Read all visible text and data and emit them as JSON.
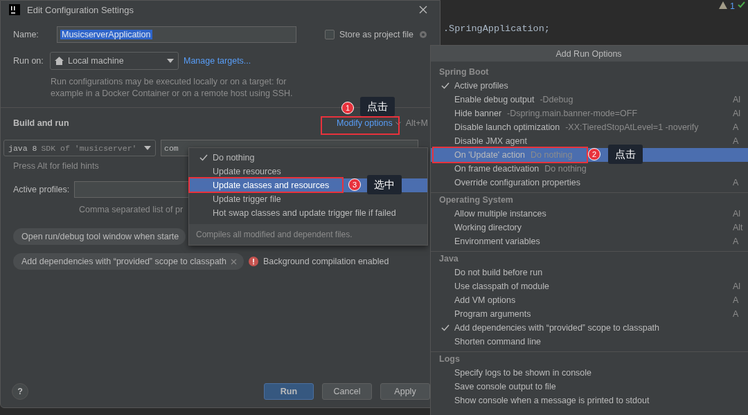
{
  "editor": {
    "code_line": ".SpringApplication;",
    "warning_count": "1"
  },
  "dialog": {
    "title": "Edit Configuration Settings",
    "name": {
      "label": "Name:",
      "value": "MusicserverApplication"
    },
    "store_as_project_file": {
      "label": "Store as project file",
      "checked": false
    },
    "run_on": {
      "label": "Run on:",
      "value": "Local machine",
      "link": "Manage targets..."
    },
    "run_on_hint": "Run configurations may be executed locally or on a target: for example in a Docker Container or on a remote host using SSH.",
    "section": "Build and run",
    "modify_options": {
      "label": "Modify options",
      "shortcut": "Alt+M"
    },
    "jre": {
      "version": "java 8",
      "sdk": "SDK of 'musicserver'"
    },
    "main_class": "com",
    "field_hints": "Press Alt for field hints",
    "active_profiles": {
      "label": "Active profiles:",
      "hint": "Comma separated list of pr"
    },
    "chips": [
      {
        "label": "Open run/debug tool window when starte",
        "removable": false
      },
      {
        "label": "Add dependencies with “provided” scope to classpath",
        "removable": true
      }
    ],
    "warning": "Background compilation enabled",
    "help": "?",
    "buttons": [
      {
        "label": "Run",
        "primary": true
      },
      {
        "label": "Cancel",
        "primary": false
      },
      {
        "label": "Apply",
        "primary": false
      }
    ]
  },
  "update_popup": {
    "items": [
      {
        "label": "Do nothing",
        "checked": true,
        "selected": false
      },
      {
        "label": "Update resources",
        "checked": false,
        "selected": false
      },
      {
        "label": "Update classes and resources",
        "checked": false,
        "selected": true
      },
      {
        "label": "Update trigger file",
        "checked": false,
        "selected": false
      },
      {
        "label": "Hot swap classes and update trigger file if failed",
        "checked": false,
        "selected": false
      }
    ],
    "footer": "Compiles all modified and dependent files."
  },
  "run_options": {
    "title": "Add Run Options",
    "sections": [
      {
        "title": "Spring Boot",
        "items": [
          {
            "label": "Active profiles",
            "checked": true,
            "selected": false
          },
          {
            "label": "Enable debug output",
            "hint": "-Ddebug",
            "shortcut": "Al",
            "checked": false,
            "selected": false
          },
          {
            "label": "Hide banner",
            "hint": "-Dspring.main.banner-mode=OFF",
            "shortcut": "Al",
            "checked": false,
            "selected": false
          },
          {
            "label": "Disable launch optimization",
            "hint": "-XX:TieredStopAtLevel=1 -noverify",
            "shortcut": "A",
            "checked": false,
            "selected": false
          },
          {
            "label": "Disable JMX agent",
            "shortcut": "A",
            "checked": false,
            "selected": false
          },
          {
            "label": "On 'Update' action",
            "hint": "Do nothing",
            "checked": false,
            "selected": true
          },
          {
            "label": "On frame deactivation",
            "hint": "Do nothing",
            "checked": false,
            "selected": false
          },
          {
            "label": "Override configuration properties",
            "shortcut": "A",
            "checked": false,
            "selected": false
          }
        ]
      },
      {
        "title": "Operating System",
        "items": [
          {
            "label": "Allow multiple instances",
            "shortcut": "Al",
            "checked": false,
            "selected": false
          },
          {
            "label": "Working directory",
            "shortcut": "Alt",
            "checked": false,
            "selected": false
          },
          {
            "label": "Environment variables",
            "shortcut": "A",
            "checked": false,
            "selected": false
          }
        ]
      },
      {
        "title": "Java",
        "items": [
          {
            "label": "Do not build before run",
            "checked": false,
            "selected": false
          },
          {
            "label": "Use classpath of module",
            "shortcut": "Al",
            "checked": false,
            "selected": false
          },
          {
            "label": "Add VM options",
            "shortcut": "A",
            "checked": false,
            "selected": false
          },
          {
            "label": "Program arguments",
            "shortcut": "A",
            "checked": false,
            "selected": false
          },
          {
            "label": "Add dependencies with “provided” scope to classpath",
            "checked": true,
            "selected": false
          },
          {
            "label": "Shorten command line",
            "checked": false,
            "selected": false
          }
        ]
      },
      {
        "title": "Logs",
        "items": [
          {
            "label": "Specify logs to be shown in console",
            "checked": false,
            "selected": false
          },
          {
            "label": "Save console output to file",
            "checked": false,
            "selected": false
          },
          {
            "label": "Show console when a message is printed to stdout",
            "checked": false,
            "selected": false
          }
        ]
      }
    ]
  },
  "annotations": [
    {
      "number": "1",
      "label": "点击"
    },
    {
      "number": "2",
      "label": "点击"
    },
    {
      "number": "3",
      "label": "选中"
    }
  ]
}
